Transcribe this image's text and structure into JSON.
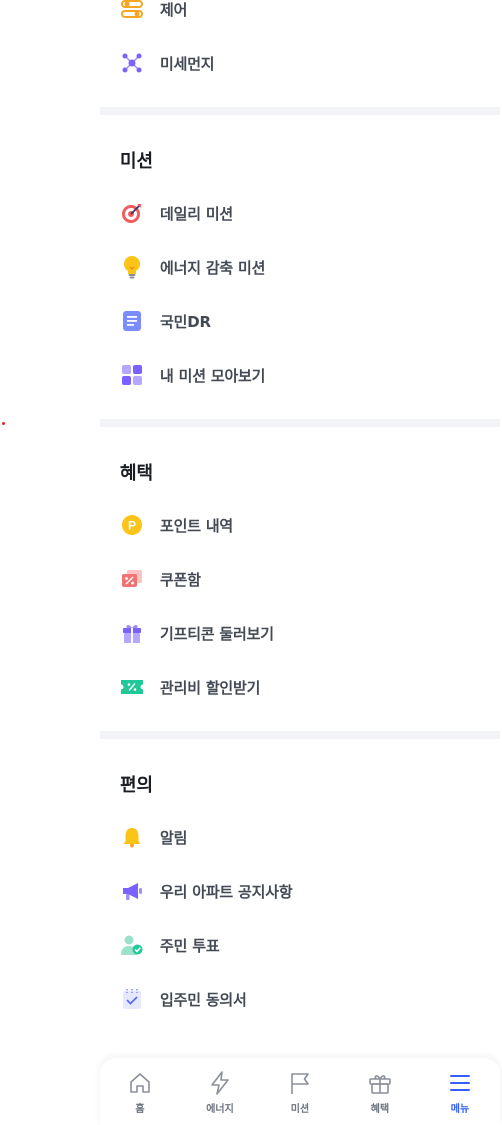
{
  "top_items": [
    {
      "label": "제어",
      "icon": "toggle-settings-icon"
    },
    {
      "label": "미세먼지",
      "icon": "dust-particles-icon"
    }
  ],
  "sections": {
    "mission": {
      "title": "미션",
      "items": [
        {
          "label": "데일리 미션",
          "icon": "target-icon"
        },
        {
          "label": "에너지 감축 미션",
          "icon": "lightbulb-icon"
        },
        {
          "label": "국민DR",
          "icon": "document-icon"
        },
        {
          "label": "내 미션 모아보기",
          "icon": "grid-icon"
        }
      ]
    },
    "benefit": {
      "title": "혜택",
      "items": [
        {
          "label": "포인트 내역",
          "icon": "point-coin-icon",
          "icon_text": "P"
        },
        {
          "label": "쿠폰함",
          "icon": "coupon-icon"
        },
        {
          "label": "기프티콘 둘러보기",
          "icon": "gift-icon"
        },
        {
          "label": "관리비 할인받기",
          "icon": "discount-ticket-icon"
        }
      ]
    },
    "convenience": {
      "title": "편의",
      "items": [
        {
          "label": "알림",
          "icon": "bell-icon"
        },
        {
          "label": "우리 아파트 공지사항",
          "icon": "megaphone-icon"
        },
        {
          "label": "주민 투표",
          "icon": "vote-user-icon"
        },
        {
          "label": "입주민 동의서",
          "icon": "calendar-check-icon"
        }
      ]
    }
  },
  "tabbar": {
    "tabs": [
      {
        "label": "홈",
        "icon": "home-icon"
      },
      {
        "label": "에너지",
        "icon": "lightning-icon"
      },
      {
        "label": "미션",
        "icon": "flag-icon"
      },
      {
        "label": "혜택",
        "icon": "gift-outline-icon"
      },
      {
        "label": "메뉴",
        "icon": "menu-icon"
      }
    ],
    "active": "메뉴"
  },
  "colors": {
    "accent": "#3560ff",
    "separator": "#f2f3f7",
    "text_dark": "#1a1d24",
    "text_item": "#444a55"
  }
}
